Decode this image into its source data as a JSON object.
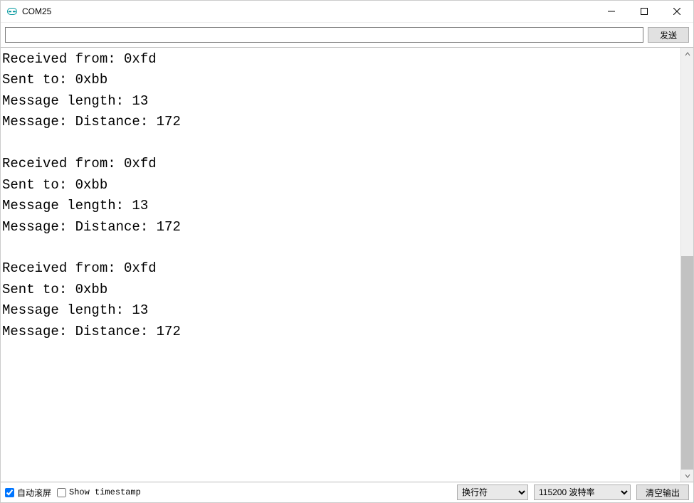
{
  "window": {
    "title": "COM25"
  },
  "toolbar": {
    "send_label": "发送",
    "input_value": ""
  },
  "console": {
    "text": "Received from: 0xfd\nSent to: 0xbb\nMessage length: 13\nMessage: Distance: 172\n\nReceived from: 0xfd\nSent to: 0xbb\nMessage length: 13\nMessage: Distance: 172\n\nReceived from: 0xfd\nSent to: 0xbb\nMessage length: 13\nMessage: Distance: 172\n"
  },
  "bottom": {
    "autoscroll_label": "自动滚屏",
    "autoscroll_checked": true,
    "timestamp_label": "Show timestamp",
    "timestamp_checked": false,
    "line_ending_selected": "换行符",
    "baud_selected": "115200 波特率",
    "clear_label": "清空输出"
  }
}
